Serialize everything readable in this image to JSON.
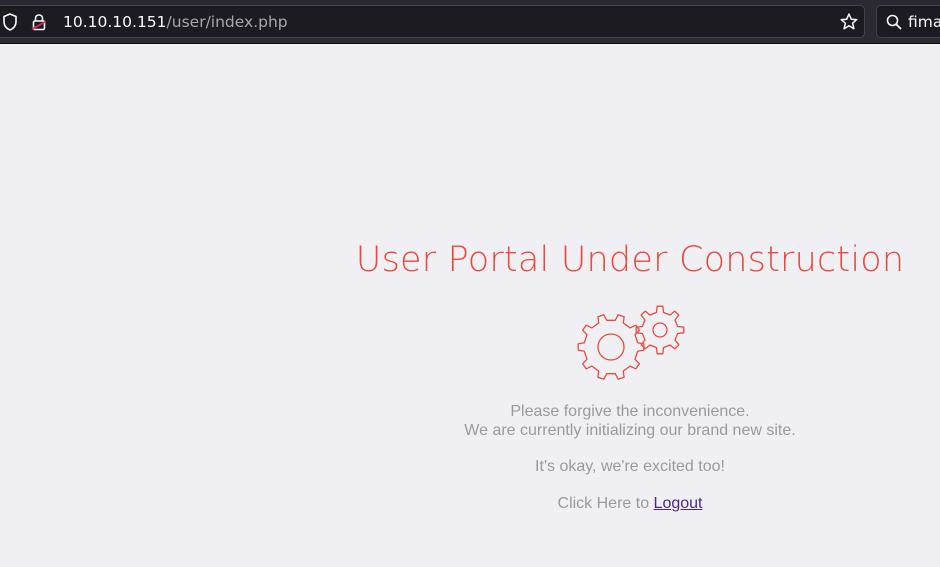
{
  "browser": {
    "url_host": "10.10.10.151",
    "url_path": "/user/index.php",
    "search_text": "fima"
  },
  "page": {
    "title": "User Portal Under Construction",
    "line1": "Please forgive the inconvenience.",
    "line2": "We are currently initializing our brand new site.",
    "line3": "It's okay, we're excited too!",
    "logout_prefix": "Click Here to ",
    "logout_label": "Logout"
  },
  "icons": {
    "shield": "shield-icon",
    "lock": "insecure-lock-icon",
    "star": "bookmark-star-icon",
    "search": "search-icon",
    "gears": "gears-icon"
  },
  "colors": {
    "accent_red": "#e74c3c",
    "muted_text": "#9a9a9a",
    "link": "#4b2a8a",
    "page_bg": "#f0eff4",
    "toolbar_bg": "#2b2a33"
  }
}
